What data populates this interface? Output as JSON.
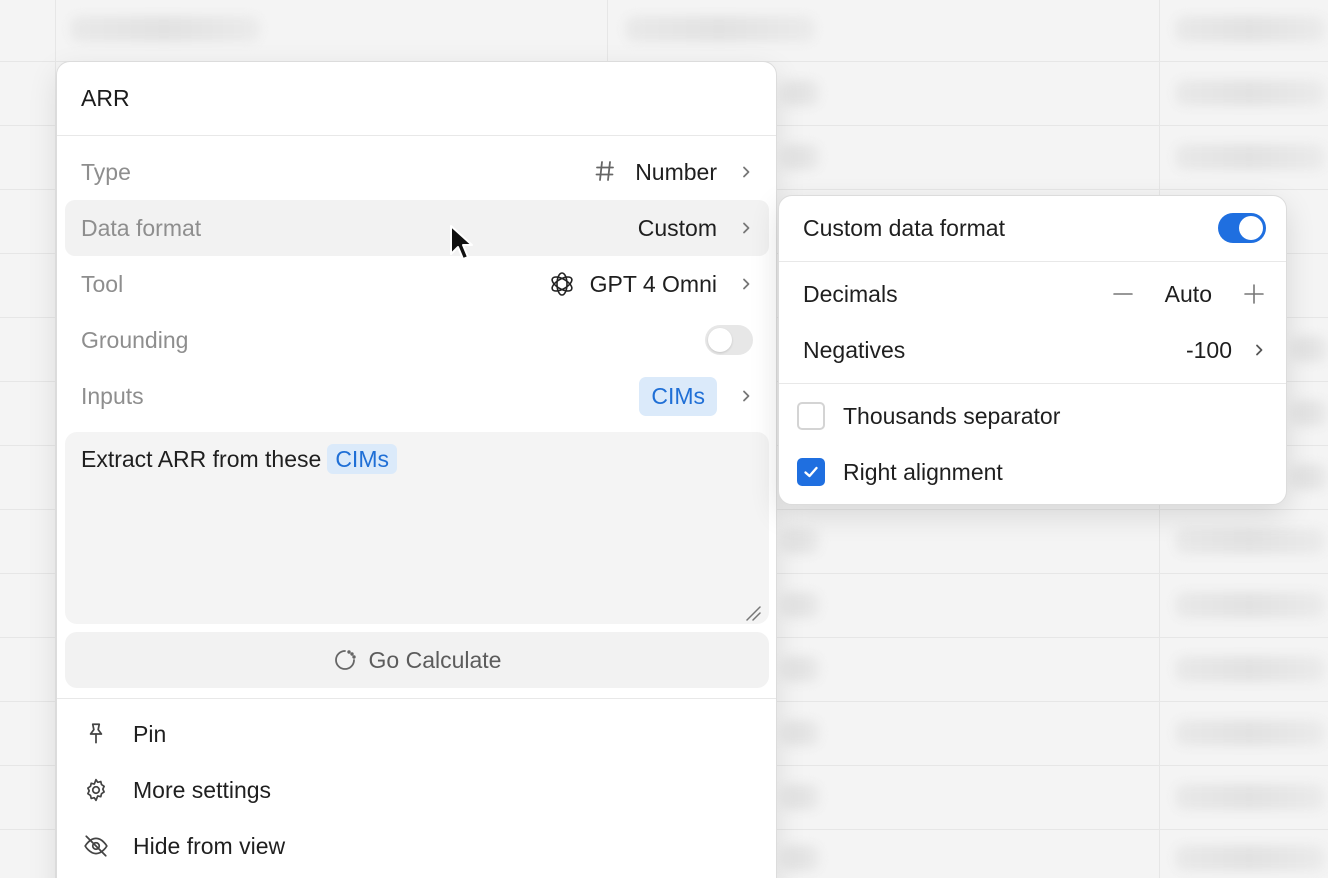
{
  "column_panel": {
    "title": "ARR",
    "properties": [
      {
        "label": "Type",
        "value": "Number",
        "icon": "hash-icon"
      },
      {
        "label": "Data format",
        "value": "Custom"
      },
      {
        "label": "Tool",
        "value": "GPT 4 Omni",
        "icon": "openai-icon"
      },
      {
        "label": "Grounding",
        "toggle": false
      },
      {
        "label": "Inputs",
        "value": "CIMs"
      }
    ],
    "prompt": {
      "text": "Extract ARR from these",
      "chip": "CIMs"
    },
    "calculate_label": "Go Calculate",
    "menu": [
      {
        "label": "Pin",
        "icon": "pin-icon"
      },
      {
        "label": "More settings",
        "icon": "gear-icon"
      },
      {
        "label": "Hide from view",
        "icon": "eye-off-icon"
      }
    ]
  },
  "data_format_panel": {
    "custom_label": "Custom data format",
    "custom_enabled": true,
    "decimals_label": "Decimals",
    "decimals_value": "Auto",
    "negatives_label": "Negatives",
    "negatives_value": "-100",
    "thousands_label": "Thousands separator",
    "thousands_checked": false,
    "right_align_label": "Right alignment",
    "right_align_checked": true
  },
  "colors": {
    "accent": "#1f6fe0",
    "chip_bg": "#dbeafa",
    "chip_text": "#1f6fd6"
  }
}
